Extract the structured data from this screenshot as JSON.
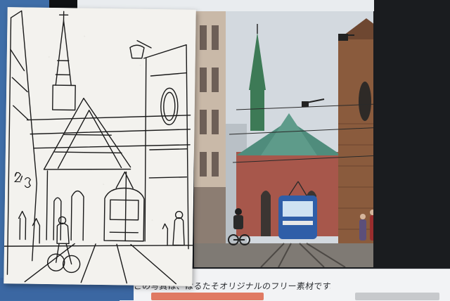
{
  "scene": {
    "sketch": {
      "name": "hand-drawn ink sketch",
      "stroke_color": "#1a1a1a",
      "paper_color": "#f3f2ee"
    },
    "screen": {
      "caption": "この写真は、はるたそオリジナルのフリー素材です。",
      "ui_chip_color": "#e07a63",
      "ui_field_color": "#c7c9cc"
    },
    "photo": {
      "sky_color": "#d7dde3",
      "brick_color": "#a7574b",
      "roof_color": "#4f8c7c",
      "spire_color": "#3d7a56",
      "tram_color": "#2f5ea8",
      "street_color": "#7f7a74"
    },
    "colors": {
      "desk_blue": "#3f6ea8",
      "monitor_black": "#1b1e22"
    }
  }
}
